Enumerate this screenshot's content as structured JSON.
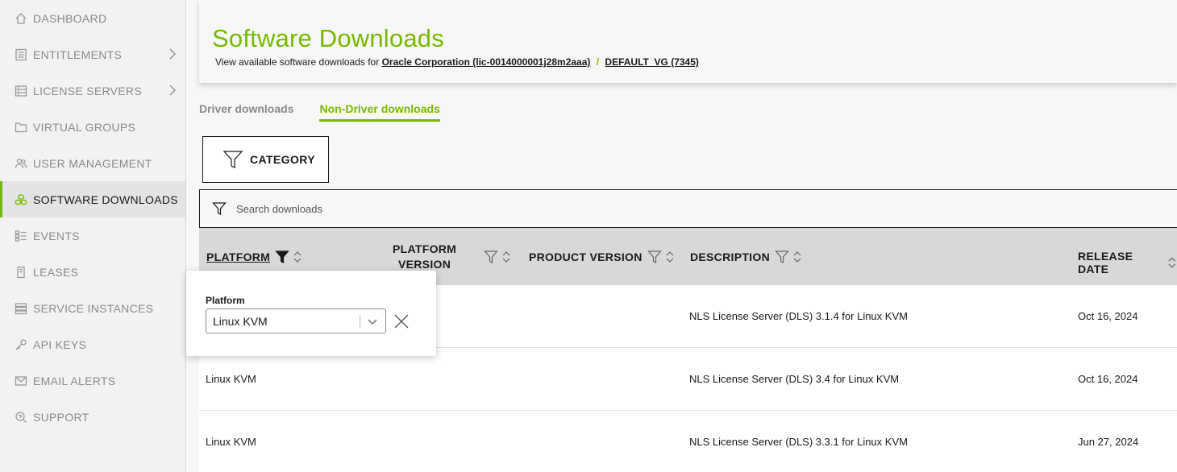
{
  "sidebar": {
    "items": [
      {
        "label": "DASHBOARD",
        "icon": "home-icon",
        "active": false,
        "chevron": false
      },
      {
        "label": "ENTITLEMENTS",
        "icon": "document-list-icon",
        "active": false,
        "chevron": true
      },
      {
        "label": "LICENSE SERVERS",
        "icon": "server-icon",
        "active": false,
        "chevron": true
      },
      {
        "label": "VIRTUAL GROUPS",
        "icon": "folder-icon",
        "active": false,
        "chevron": false
      },
      {
        "label": "USER MANAGEMENT",
        "icon": "users-icon",
        "active": false,
        "chevron": false
      },
      {
        "label": "SOFTWARE DOWNLOADS",
        "icon": "cubes-icon",
        "active": true,
        "chevron": false
      },
      {
        "label": "EVENTS",
        "icon": "events-list-icon",
        "active": false,
        "chevron": false
      },
      {
        "label": "LEASES",
        "icon": "lease-icon",
        "active": false,
        "chevron": false
      },
      {
        "label": "SERVICE INSTANCES",
        "icon": "instances-icon",
        "active": false,
        "chevron": false
      },
      {
        "label": "API KEYS",
        "icon": "key-icon",
        "active": false,
        "chevron": false
      },
      {
        "label": "EMAIL ALERTS",
        "icon": "mail-icon",
        "active": false,
        "chevron": false
      },
      {
        "label": "SUPPORT",
        "icon": "support-icon",
        "active": false,
        "chevron": false
      }
    ]
  },
  "header": {
    "title": "Software Downloads",
    "subtitle_prefix": "View available software downloads for",
    "org_link": "Oracle Corporation (lic-0014000001j28m2aaa)",
    "separator": "/",
    "vg_link": "DEFAULT_VG (7345)"
  },
  "tabs": [
    {
      "label": "Driver downloads",
      "active": false
    },
    {
      "label": "Non-Driver downloads",
      "active": true
    }
  ],
  "category_button": {
    "label": "CATEGORY"
  },
  "search": {
    "placeholder": "Search downloads"
  },
  "table": {
    "columns": {
      "platform": "PLATFORM",
      "platform_version_1": "PLATFORM",
      "platform_version_2": "VERSION",
      "product_version": "PRODUCT VERSION",
      "description": "DESCRIPTION",
      "release_date": "RELEASE DATE"
    },
    "rows": [
      {
        "platform": "",
        "platform_version": "",
        "product_version": "",
        "description": "NLS License Server (DLS) 3.1.4 for Linux KVM",
        "release_date": "Oct 16, 2024"
      },
      {
        "platform": "Linux KVM",
        "platform_version": "",
        "product_version": "",
        "description": "NLS License Server (DLS) 3.4 for Linux KVM",
        "release_date": "Oct 16, 2024"
      },
      {
        "platform": "Linux KVM",
        "platform_version": "",
        "product_version": "",
        "description": "NLS License Server (DLS) 3.3.1 for Linux KVM",
        "release_date": "Jun 27, 2024"
      }
    ]
  },
  "filter_popover": {
    "label": "Platform",
    "selected": "Linux KVM"
  },
  "colors": {
    "accent": "#76b900",
    "sidebar_bg": "#f2f2f2",
    "header_row_bg": "#d8d8d8"
  }
}
